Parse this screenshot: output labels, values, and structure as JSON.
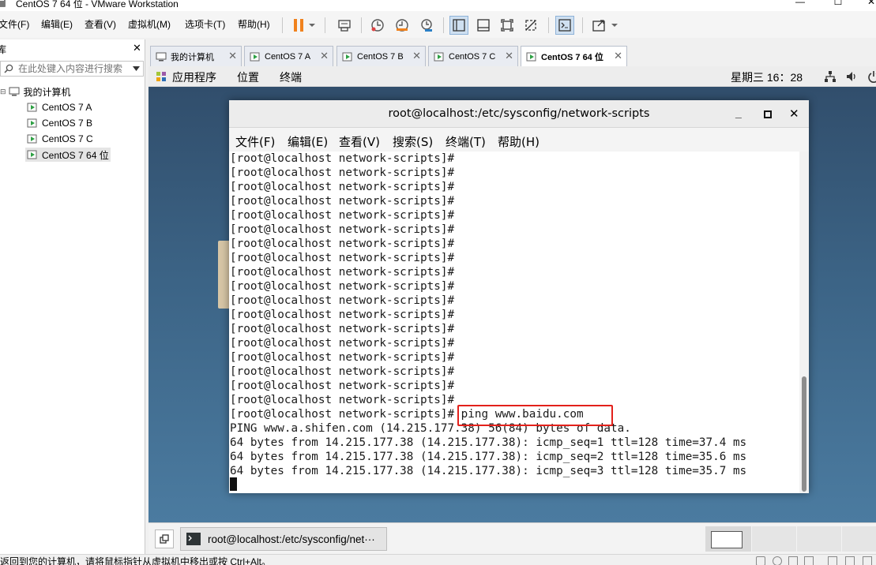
{
  "window": {
    "title": "CentOS 7 64 位 - VMware Workstation"
  },
  "menubar": {
    "items": [
      "文件(F)",
      "编辑(E)",
      "查看(V)",
      "虚拟机(M)",
      "选项卡(T)",
      "帮助(H)"
    ]
  },
  "library": {
    "search_placeholder": "在此处键入内容进行搜索",
    "root": "我的计算机",
    "vms": [
      "CentOS 7 A",
      "CentOS 7 B",
      "CentOS 7 C",
      "CentOS 7 64 位"
    ],
    "selected": "CentOS 7 64 位"
  },
  "tabs": [
    {
      "label": "我的计算机",
      "icon": "home-monitor-icon",
      "active": false
    },
    {
      "label": "CentOS 7 A",
      "icon": "vm-icon",
      "active": false
    },
    {
      "label": "CentOS 7 B",
      "icon": "vm-icon",
      "active": false
    },
    {
      "label": "CentOS 7 C",
      "icon": "vm-icon",
      "active": false
    },
    {
      "label": "CentOS 7 64 位",
      "icon": "vm-icon",
      "active": true
    }
  ],
  "guest_topbar": {
    "applications": "应用程序",
    "places": "位置",
    "terminal": "终端",
    "clock": "星期三 16：28"
  },
  "terminal": {
    "title": "root@localhost:/etc/sysconfig/network-scripts",
    "menu": [
      "文件(F)",
      "编辑(E)",
      "查看(V)",
      "搜索(S)",
      "终端(T)",
      "帮助(H)"
    ],
    "prompt_line": "[root@localhost network-scripts]#",
    "prompt_repeat": 18,
    "command_line": "[root@localhost network-scripts]# ping www.baidu.com",
    "output": [
      "PING www.a.shifen.com (14.215.177.38) 56(84) bytes of data.",
      "64 bytes from 14.215.177.38 (14.215.177.38): icmp_seq=1 ttl=128 time=37.4 ms",
      "64 bytes from 14.215.177.38 (14.215.177.38): icmp_seq=2 ttl=128 time=35.6 ms",
      "64 bytes from 14.215.177.38 (14.215.177.38): icmp_seq=3 ttl=128 time=35.7 ms"
    ]
  },
  "guest_taskbar": {
    "window_item": "root@localhost:/etc/sysconfig/net···"
  },
  "statusbar": {
    "text": "要返回到您的计算机，请将鼠标指针从虚拟机中移出或按 Ctrl+Alt。"
  },
  "colors": {
    "highlight_box": "#e3211b",
    "pause_button": "#f0821e",
    "desktop": "#3c6486"
  }
}
